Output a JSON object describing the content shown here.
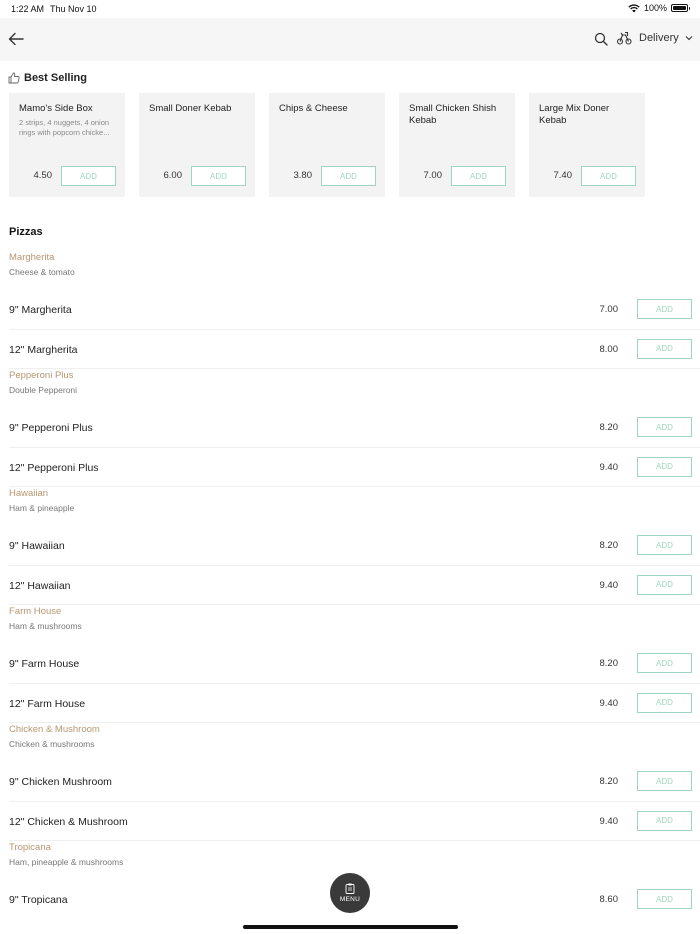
{
  "status_bar": {
    "time": "1:22 AM",
    "date": "Thu Nov 10",
    "battery": "100%"
  },
  "nav": {
    "delivery_label": "Delivery",
    "icons": [
      "back-arrow-icon",
      "search-icon",
      "delivery-scooter-icon",
      "chevron-down-icon"
    ]
  },
  "best_selling": {
    "title": "Best Selling",
    "items": [
      {
        "name": "Mamo's Side Box",
        "desc": "2 strips, 4 nuggets, 4 onion rings with popcorn chicke...",
        "price": "4.50",
        "add": "ADD"
      },
      {
        "name": "Small Doner Kebab",
        "desc": "",
        "price": "6.00",
        "add": "ADD"
      },
      {
        "name": "Chips & Cheese",
        "desc": "",
        "price": "3.80",
        "add": "ADD"
      },
      {
        "name": "Small Chicken Shish Kebab",
        "desc": "",
        "price": "7.00",
        "add": "ADD"
      },
      {
        "name": "Large Mix Doner Kebab",
        "desc": "",
        "price": "7.40",
        "add": "ADD"
      }
    ]
  },
  "pizzas": {
    "title": "Pizzas",
    "groups": [
      {
        "name": "Margherita",
        "desc": "Cheese & tomato",
        "rows": [
          {
            "name": "9\" Margherita",
            "price": "7.00",
            "add": "ADD"
          },
          {
            "name": "12\" Margherita",
            "price": "8.00",
            "add": "ADD"
          }
        ]
      },
      {
        "name": "Pepperoni Plus",
        "desc": "Double Pepperoni",
        "rows": [
          {
            "name": "9\" Pepperoni Plus",
            "price": "8.20",
            "add": "ADD"
          },
          {
            "name": "12\" Pepperoni Plus",
            "price": "9.40",
            "add": "ADD"
          }
        ]
      },
      {
        "name": "Hawaiian",
        "desc": "Ham & pineapple",
        "rows": [
          {
            "name": "9\" Hawaiian",
            "price": "8.20",
            "add": "ADD"
          },
          {
            "name": "12\" Hawaiian",
            "price": "9.40",
            "add": "ADD"
          }
        ]
      },
      {
        "name": "Farm House",
        "desc": "Ham & mushrooms",
        "rows": [
          {
            "name": "9\" Farm House",
            "price": "8.20",
            "add": "ADD"
          },
          {
            "name": "12\" Farm House",
            "price": "9.40",
            "add": "ADD"
          }
        ]
      },
      {
        "name": "Chicken & Mushroom",
        "desc": "Chicken & mushrooms",
        "rows": [
          {
            "name": "9\" Chicken Mushroom",
            "price": "8.20",
            "add": "ADD"
          },
          {
            "name": "12\" Chicken & Mushroom",
            "price": "9.40",
            "add": "ADD"
          }
        ]
      },
      {
        "name": "Tropicana",
        "desc": "Ham, pineapple & mushrooms",
        "rows": [
          {
            "name": "9\" Tropicana",
            "price": "8.60",
            "add": "ADD"
          }
        ]
      }
    ]
  },
  "menu_button": {
    "label": "MENU"
  },
  "colors": {
    "accent_add": "#9fd6bf",
    "group_name": "#b79670",
    "card_bg": "#f3f3f3",
    "nav_bg": "#f6f6f6",
    "menu_bg": "#3a3a3a"
  }
}
